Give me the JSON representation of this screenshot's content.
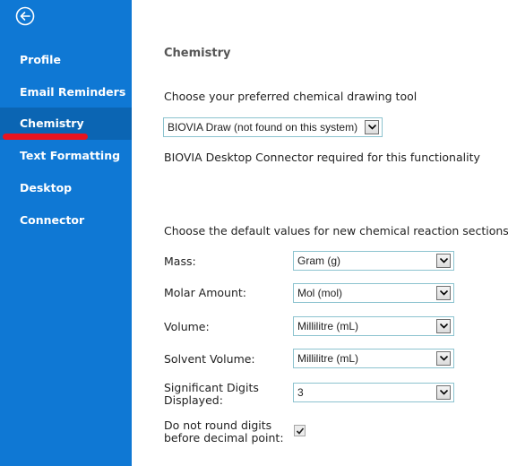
{
  "sidebar": {
    "back_icon": "arrow-left-circle-icon",
    "items": [
      {
        "label": "Profile",
        "active": false
      },
      {
        "label": "Email Reminders",
        "active": false
      },
      {
        "label": "Chemistry",
        "active": true
      },
      {
        "label": "Text Formatting",
        "active": false
      },
      {
        "label": "Desktop Connector",
        "active": false
      }
    ]
  },
  "main": {
    "title": "Chemistry",
    "drawing_tool_prompt": "Choose your preferred chemical drawing tool",
    "drawing_tool_value": "BIOVIA Draw (not found on this system)",
    "connector_note": "BIOVIA Desktop Connector required for this functionality",
    "defaults_prompt": "Choose the default values for new chemical reaction sections",
    "fields": [
      {
        "label": "Mass:",
        "value": "Gram (g)"
      },
      {
        "label": "Molar Amount:",
        "value": "Mol (mol)"
      },
      {
        "label": "Volume:",
        "value": "Millilitre (mL)"
      },
      {
        "label": "Solvent Volume:",
        "value": "Millilitre (mL)"
      },
      {
        "label_line1": "Significant Digits",
        "label_line2": "Displayed:",
        "value": "3"
      }
    ],
    "round_checkbox": {
      "label_line1": "Do not round digits",
      "label_line2": "before decimal point:",
      "checked": true
    }
  },
  "colors": {
    "sidebar": "#0f78d4",
    "active_item": "#0b65b3",
    "highlight": "#e8141e"
  }
}
